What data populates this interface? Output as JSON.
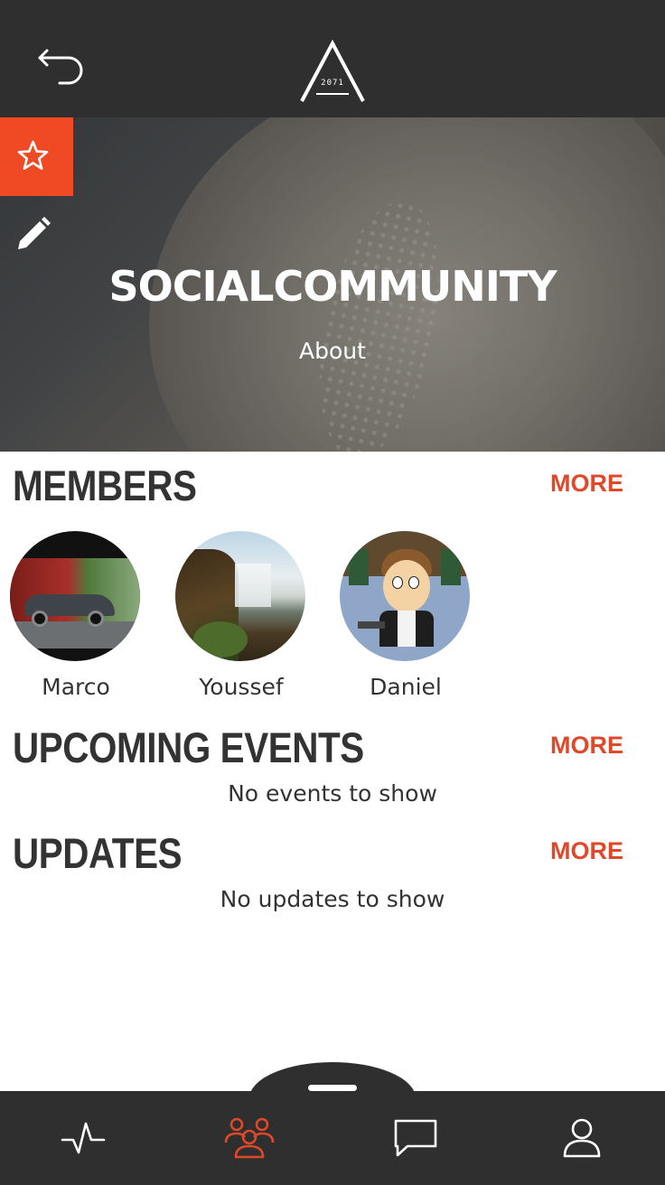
{
  "header": {
    "back_icon": "back-arrow-icon",
    "logo_icon": "a-triangle-logo",
    "logo_text": "2071"
  },
  "hero": {
    "title": "SOCIALCOMMUNITY",
    "about_label": "About",
    "favorite_icon": "star-icon",
    "edit_icon": "pencil-icon",
    "accent_color": "#f04a24"
  },
  "members": {
    "title": "MEMBERS",
    "more_label": "MORE",
    "items": [
      {
        "name": "Marco",
        "avatar": "car-photo"
      },
      {
        "name": "Youssef",
        "avatar": "waterfall-photo"
      },
      {
        "name": "Daniel",
        "avatar": "cartoon-character"
      }
    ]
  },
  "events": {
    "title": "UPCOMING EVENTS",
    "more_label": "MORE",
    "empty_text": "No events to show"
  },
  "updates": {
    "title": "UPDATES",
    "more_label": "MORE",
    "empty_text": "No updates to show"
  },
  "tabbar": {
    "items": [
      {
        "icon": "activity-pulse-icon",
        "active": false
      },
      {
        "icon": "group-icon",
        "active": true
      },
      {
        "icon": "chat-bubble-icon",
        "active": false
      },
      {
        "icon": "profile-icon",
        "active": false
      }
    ],
    "active_color": "#e0482a",
    "inactive_color": "#ffffff"
  }
}
